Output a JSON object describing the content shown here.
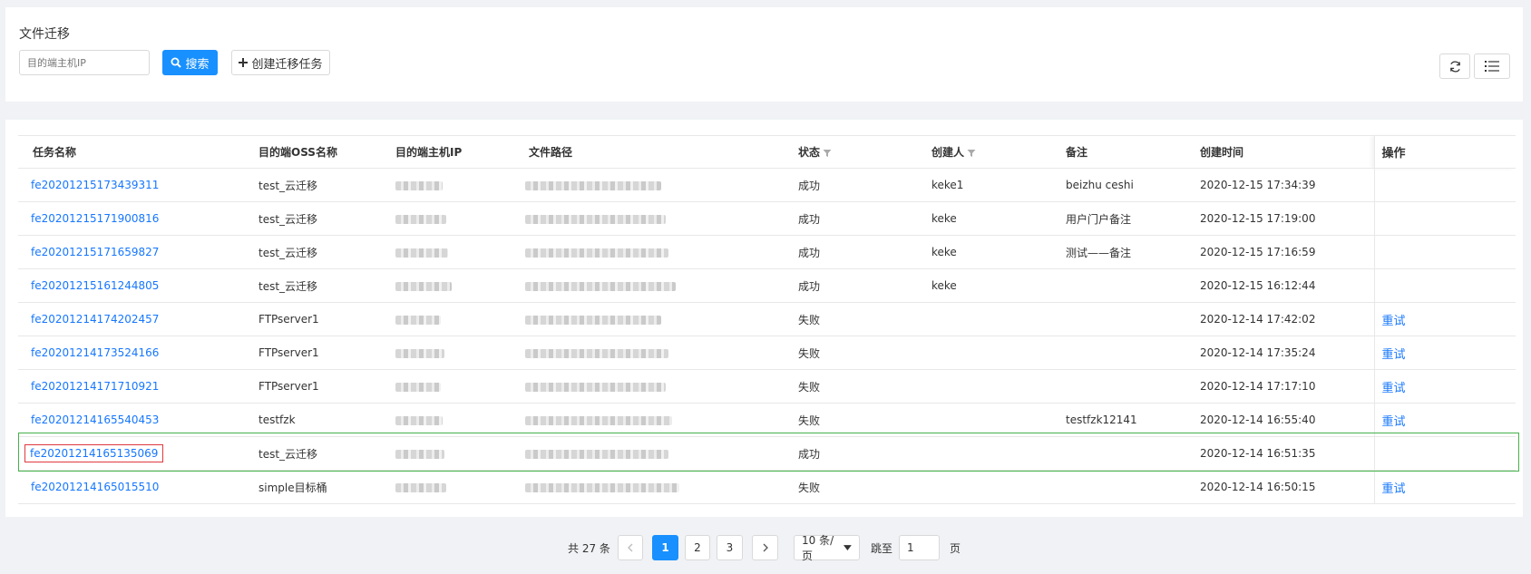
{
  "header": {
    "title": "文件迁移",
    "search_placeholder": "目的端主机IP",
    "search_button": "搜索",
    "create_button": "创建迁移任务"
  },
  "table": {
    "columns": [
      "任务名称",
      "目的端OSS名称",
      "目的端主机IP",
      "文件路径",
      "状态",
      "创建人",
      "备注",
      "创建时间",
      "操作"
    ],
    "rows": [
      {
        "name": "fe20201215173439311",
        "oss": "test_云迁移",
        "status": "成功",
        "creator": "keke1",
        "note": "beizhu ceshi",
        "time": "2020-12-15 17:34:39",
        "action": ""
      },
      {
        "name": "fe20201215171900816",
        "oss": "test_云迁移",
        "status": "成功",
        "creator": "keke",
        "note": "用户门户备注",
        "time": "2020-12-15 17:19:00",
        "action": ""
      },
      {
        "name": "fe20201215171659827",
        "oss": "test_云迁移",
        "status": "成功",
        "creator": "keke",
        "note": "测试——备注",
        "time": "2020-12-15 17:16:59",
        "action": ""
      },
      {
        "name": "fe20201215161244805",
        "oss": "test_云迁移",
        "status": "成功",
        "creator": "keke",
        "note": "",
        "time": "2020-12-15 16:12:44",
        "action": ""
      },
      {
        "name": "fe20201214174202457",
        "oss": "FTPserver1",
        "status": "失败",
        "creator": "",
        "note": "",
        "time": "2020-12-14 17:42:02",
        "action": "重试"
      },
      {
        "name": "fe20201214173524166",
        "oss": "FTPserver1",
        "status": "失败",
        "creator": "",
        "note": "",
        "time": "2020-12-14 17:35:24",
        "action": "重试"
      },
      {
        "name": "fe20201214171710921",
        "oss": "FTPserver1",
        "status": "失败",
        "creator": "",
        "note": "",
        "time": "2020-12-14 17:17:10",
        "action": "重试"
      },
      {
        "name": "fe20201214165540453",
        "oss": "testfzk",
        "status": "失败",
        "creator": "",
        "note": "testfzk12141",
        "time": "2020-12-14 16:55:40",
        "action": "重试"
      },
      {
        "name": "fe20201214165135069",
        "oss": "test_云迁移",
        "status": "成功",
        "creator": "",
        "note": "",
        "time": "2020-12-14 16:51:35",
        "action": ""
      },
      {
        "name": "fe20201214165015510",
        "oss": "simple目标桶",
        "status": "失败",
        "creator": "",
        "note": "",
        "time": "2020-12-14 16:50:15",
        "action": "重试"
      }
    ]
  },
  "pagination": {
    "total": "共 27 条",
    "pages": [
      "1",
      "2",
      "3"
    ],
    "current": "1",
    "page_size": "10 条/页",
    "goto_label": "跳至",
    "goto_value": "1",
    "page_unit": "页"
  },
  "colors": {
    "primary": "#1890ff",
    "link": "#1677ff",
    "highlight_row": "#46b24b",
    "highlight_name": "#e0393e"
  }
}
